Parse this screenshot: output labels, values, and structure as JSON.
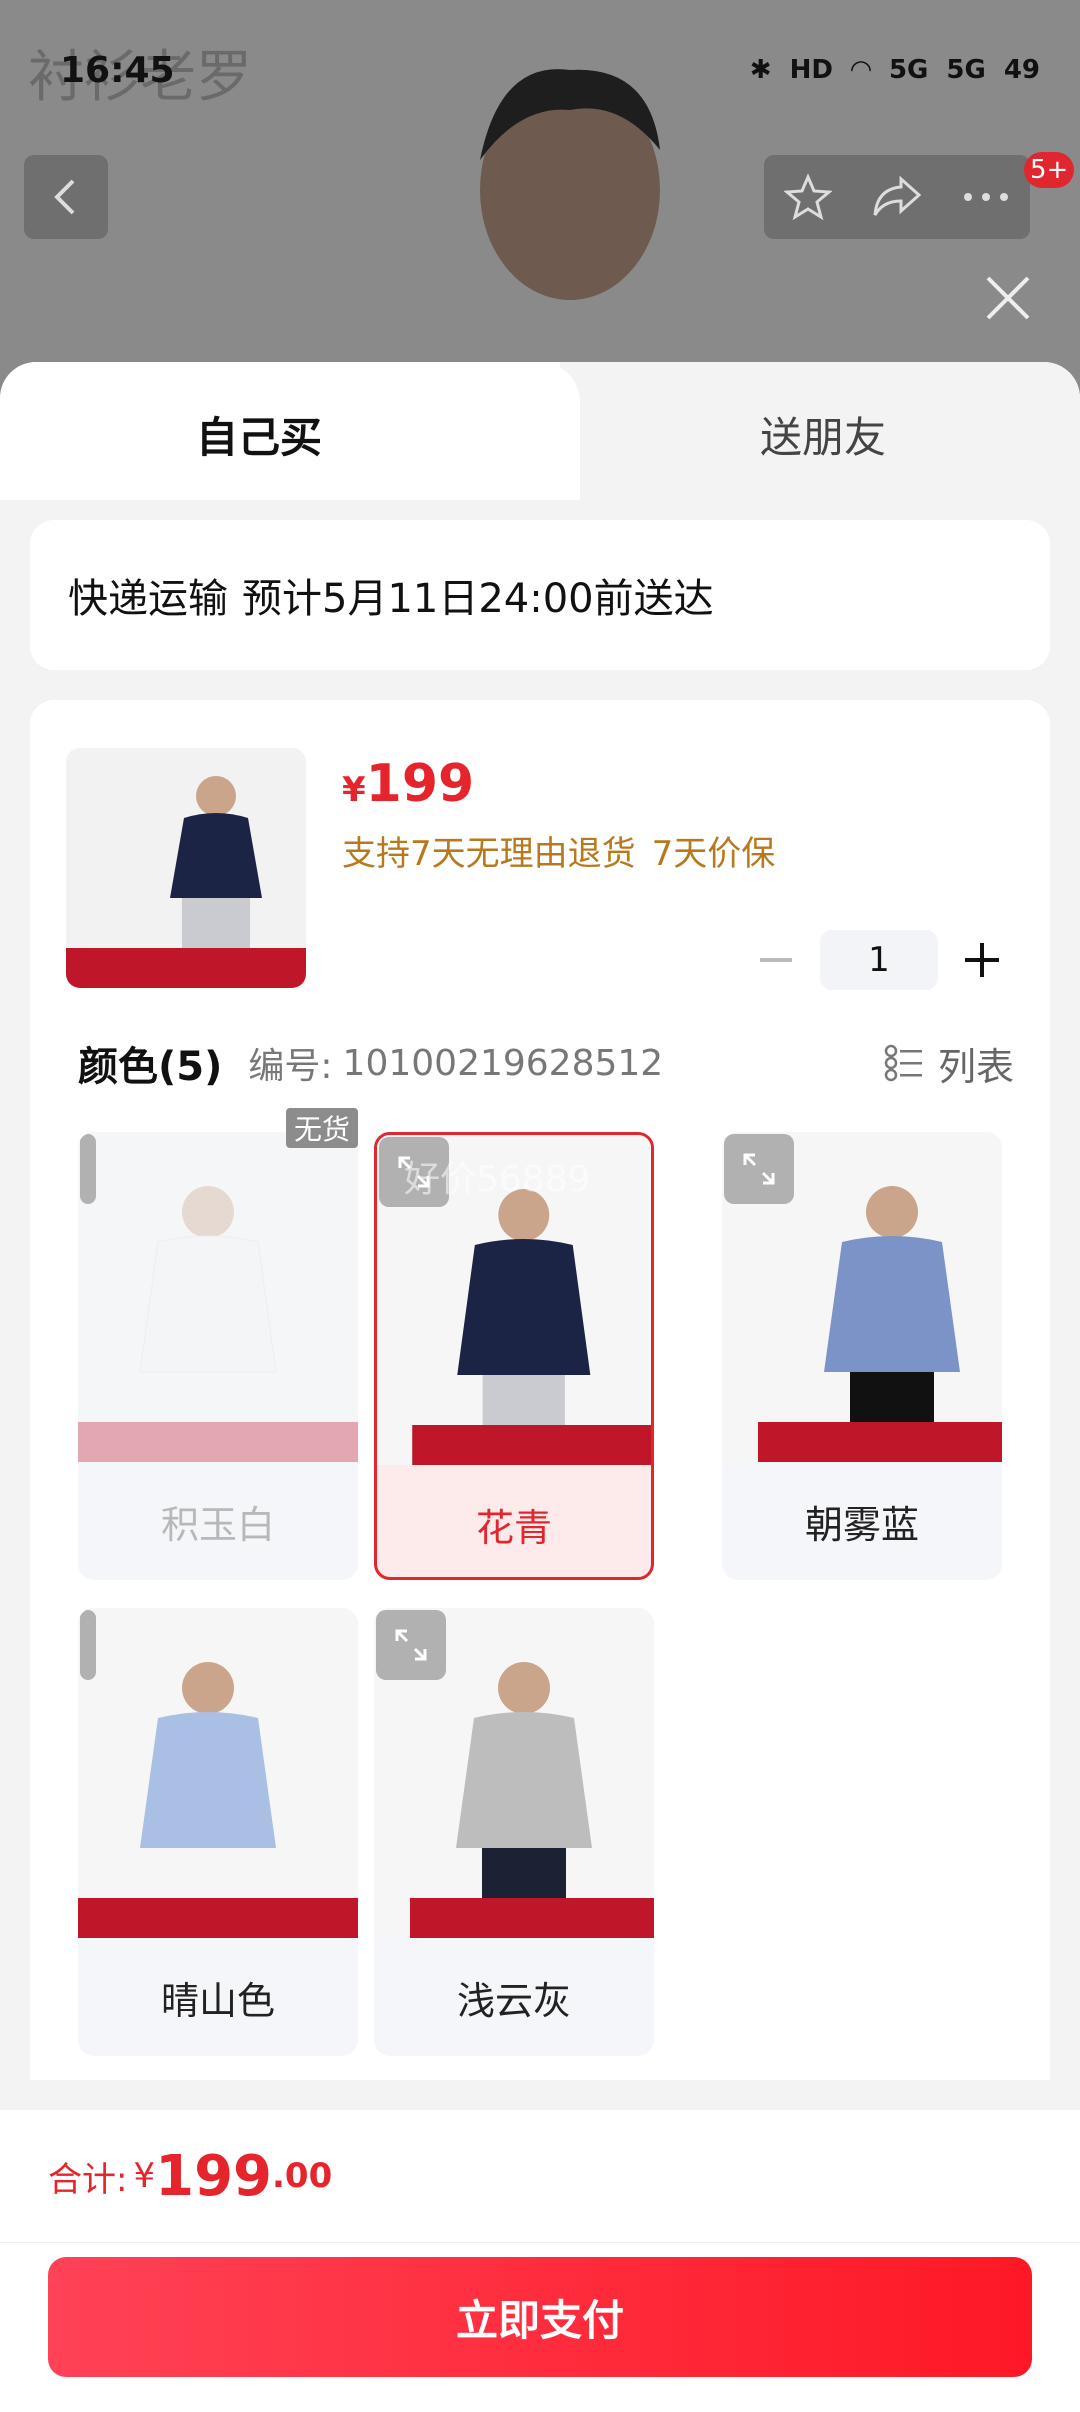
{
  "status_bar": {
    "time": "16:45",
    "network": "HD",
    "signal_1": "5G",
    "signal_2": "5G",
    "battery": "49"
  },
  "background": {
    "brand": "衬衫老罗",
    "message_badge": "5+"
  },
  "tabs": {
    "self": "自己买",
    "friend": "送朋友"
  },
  "delivery": {
    "method": "快递运输",
    "eta": "预计5月11日24:00前送达"
  },
  "product": {
    "price_symbol": "¥",
    "price": "199",
    "promise_1": "支持7天无理由退货",
    "promise_2": "7天价保",
    "quantity": "1"
  },
  "color_section": {
    "title": "颜色(5)",
    "code_label": "编号:",
    "code_value": "10100219628512",
    "list_label": "列表"
  },
  "colors": [
    {
      "name": "积玉白",
      "status": "无货",
      "shirt_color": "#f4f4f4"
    },
    {
      "name": "花青",
      "shirt_color": "#1b2444"
    },
    {
      "name": "朝雾蓝",
      "shirt_color": "#7b93c6"
    },
    {
      "name": "晴山色",
      "shirt_color": "#a9bfe3"
    },
    {
      "name": "浅云灰",
      "shirt_color": "#bdbdbd"
    }
  ],
  "watermark": "好价56889",
  "total": {
    "label": "合计:",
    "symbol": "¥",
    "integer": "199",
    "decimal": ".00"
  },
  "pay_button": "立即支付",
  "colors_theme": {
    "accent": "#e0262e",
    "promise": "#b8791e"
  }
}
